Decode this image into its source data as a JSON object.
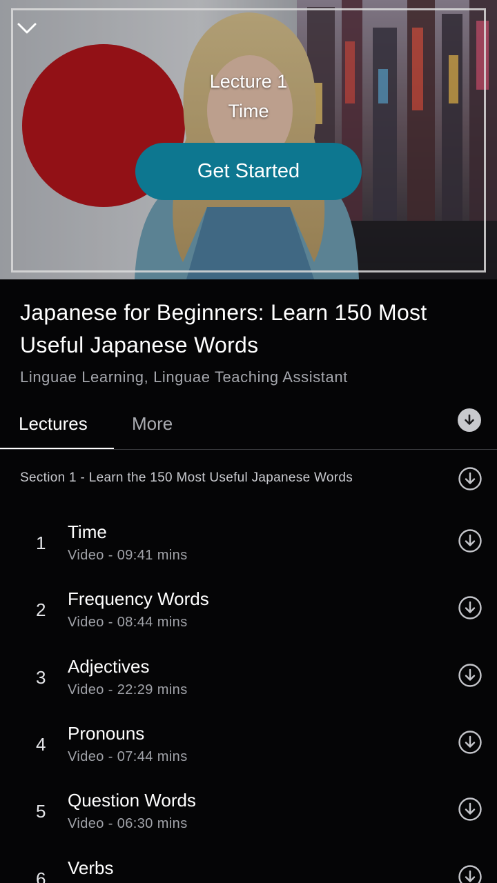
{
  "hero": {
    "lecture_label": "Lecture 1",
    "lecture_title": "Time",
    "cta": "Get Started"
  },
  "course": {
    "title": "Japanese for Beginners: Learn 150 Most Useful Japanese Words",
    "authors": "Linguae Learning, Linguae Teaching Assistant"
  },
  "tabs": {
    "lectures": "Lectures",
    "more": "More"
  },
  "section": {
    "title": "Section 1 - Learn the 150 Most Useful Japanese Words"
  },
  "lectures": [
    {
      "num": "1",
      "title": "Time",
      "meta": "Video - 09:41 mins"
    },
    {
      "num": "2",
      "title": "Frequency Words",
      "meta": "Video - 08:44 mins"
    },
    {
      "num": "3",
      "title": "Adjectives",
      "meta": "Video - 22:29 mins"
    },
    {
      "num": "4",
      "title": "Pronouns",
      "meta": "Video - 07:44 mins"
    },
    {
      "num": "5",
      "title": "Question Words",
      "meta": "Video - 06:30 mins"
    },
    {
      "num": "6",
      "title": "Verbs",
      "meta": ""
    }
  ],
  "colors": {
    "background": "#050506",
    "accent": "#0d7790",
    "muted_text": "#a0a2a8"
  },
  "icons": [
    "chevron-down-icon",
    "download-icon"
  ]
}
